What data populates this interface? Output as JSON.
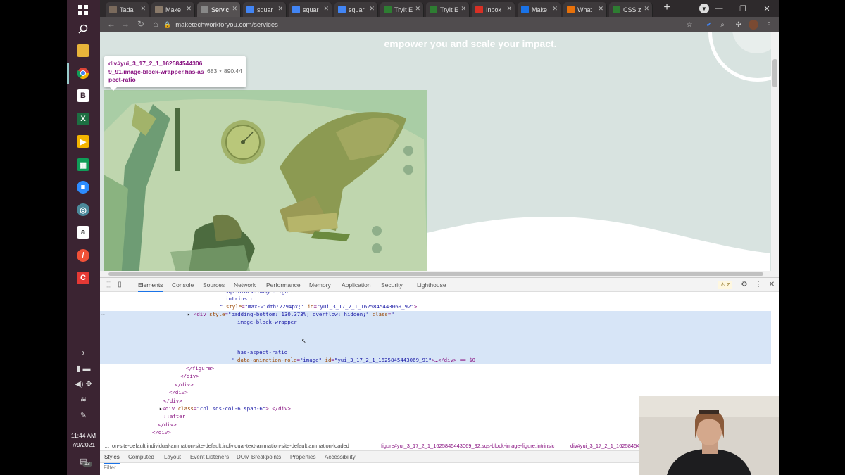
{
  "taskbar": {
    "time": "11:44 AM",
    "date": "7/9/2021",
    "notification_count": "13",
    "apps": [
      "windows-start",
      "search",
      "file-explorer",
      "chrome",
      "app-b",
      "excel",
      "slides",
      "sheets",
      "zoom",
      "chrome-canary",
      "signature-app",
      "swift-app",
      "red-app"
    ]
  },
  "browser": {
    "tabs": [
      {
        "label": "Tada",
        "color": "#7a6a5c"
      },
      {
        "label": "Make",
        "color": "#8a7a6a"
      },
      {
        "label": "Servic",
        "color": "#888"
      },
      {
        "label": "squar",
        "color": "#4285f4"
      },
      {
        "label": "squar",
        "color": "#4285f4"
      },
      {
        "label": "squar",
        "color": "#4285f4"
      },
      {
        "label": "TryIt E",
        "color": "#2e7d32"
      },
      {
        "label": "TryIt E",
        "color": "#2e7d32"
      },
      {
        "label": "Inbox",
        "color": "#d93025"
      },
      {
        "label": "Make",
        "color": "#1a73e8"
      },
      {
        "label": "What",
        "color": "#e8710a"
      },
      {
        "label": "CSS z",
        "color": "#2e7d32"
      }
    ],
    "active_tab_index": 2,
    "url": "maketechworkforyou.com/services"
  },
  "page": {
    "hero_text": "empower you and scale your impact.",
    "tooltip": {
      "selector": "div#yui_3_17_2_1_1625845443069_91.image-block-wrapper.has-aspect-ratio",
      "dimensions": "683 × 890.44"
    }
  },
  "devtools": {
    "tabs": [
      "Elements",
      "Console",
      "Sources",
      "Network",
      "Performance",
      "Memory",
      "Application",
      "Security",
      "Lighthouse"
    ],
    "active_tab": "Elements",
    "warning_count": "7",
    "dom_lines": {
      "l0": "sqs-block-image-figure",
      "l1": "intrinsic",
      "l2_attr": "style",
      "l2_val": "\"max-width:2294px;\"",
      "l2_id": "id",
      "l2_idval": "\"yui_3_17_2_1_1625845443069_92\"",
      "l3_tag": "<div",
      "l3_attr": "style",
      "l3_val": "\"padding-bottom: 130.373%; overflow: hidden;\"",
      "l3_class": "class",
      "l4": "image-block-wrapper",
      "l5": "has-aspect-ratio",
      "l6_attr": "data-animation-role",
      "l6_val": "\"image\"",
      "l6_id": "id",
      "l6_idval": "\"yui_3_17_2_1_1625845443069_91\"",
      "l6_tail": ">…</div> == $0",
      "l7": "</figure>",
      "l8": "</div>",
      "l9": "</div>",
      "l10": "</div>",
      "l11": "</div>",
      "l12_tag": "<div",
      "l12_attr": "class",
      "l12_val": "\"col sqs-col-6 span-6\"",
      "l12_tail": ">…</div>",
      "l13": "::after",
      "l14": "</div>",
      "l15": "</div>"
    },
    "breadcrumbs": {
      "c1": "on-site-default.individual-animation-site-default.individual-text-animation-site-default.animation-loaded",
      "c2": "figure#yui_3_17_2_1_1625845443069_92.sqs-block-image-figure.intrinsic",
      "c3": "div#yui_3_17_2_1_16258454"
    },
    "style_tabs": [
      "Styles",
      "Computed",
      "Layout",
      "Event Listeners",
      "DOM Breakpoints",
      "Properties",
      "Accessibility"
    ],
    "filter_placeholder": "Filter"
  }
}
